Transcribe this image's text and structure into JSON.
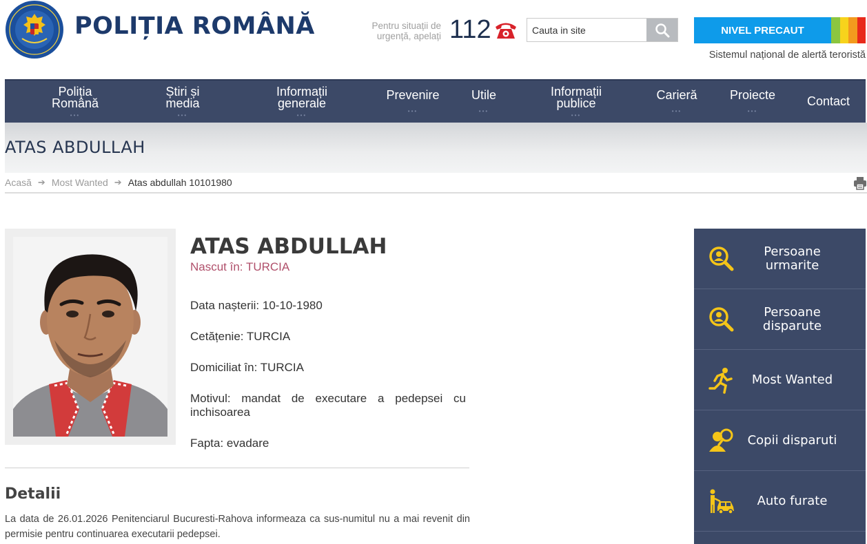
{
  "header": {
    "site_title": "POLIȚIA ROMÂNĂ",
    "emergency_text_1": "Pentru situații de",
    "emergency_text_2": "urgență, apelați",
    "emergency_number": "112",
    "search_placeholder": "Cauta in site",
    "alert_level": "NIVEL PRECAUT",
    "alert_subtitle": "Sistemul național de alertă teroristă",
    "alert_colors": [
      "#8cc63f",
      "#f7d31c",
      "#f39a1e",
      "#e8291b"
    ]
  },
  "nav": {
    "items": [
      {
        "label_1": "Poliția",
        "label_2": "Română"
      },
      {
        "label_1": "Știri și",
        "label_2": "media"
      },
      {
        "label_1": "Informații",
        "label_2": "generale"
      },
      {
        "label_1": "Prevenire",
        "label_2": ""
      },
      {
        "label_1": "Utile",
        "label_2": ""
      },
      {
        "label_1": "Informații",
        "label_2": "publice"
      },
      {
        "label_1": "Carieră",
        "label_2": ""
      },
      {
        "label_1": "Proiecte",
        "label_2": ""
      },
      {
        "label_1": "Contact",
        "label_2": ""
      }
    ],
    "dots": "•••"
  },
  "page": {
    "title": "ATAS ABDULLAH"
  },
  "breadcrumb": {
    "home": "Acasă",
    "section": "Most Wanted",
    "current": "Atas abdullah 10101980",
    "separator": "➔"
  },
  "profile": {
    "name": "ATAS ABDULLAH",
    "born": "Nascut în: TURCIA",
    "birth_date": "Data nașterii: 10-10-1980",
    "citizenship": "Cetățenie: TURCIA",
    "residence": "Domiciliat în: TURCIA",
    "reason": "Motivul: mandat de executare a pedepsei cu inchisoarea",
    "offense": "Fapta: evadare"
  },
  "details": {
    "heading": "Detalii",
    "text": "La data de 26.01.2026 Penitenciarul Bucuresti-Rahova informeaza ca sus-numitul nu a mai revenit din permisie pentru continuarea executarii pedepsei."
  },
  "sidebar": {
    "items": [
      {
        "label": "Persoane urmarite",
        "icon": "search-person-icon"
      },
      {
        "label": "Persoane disparute",
        "icon": "search-person-icon"
      },
      {
        "label": "Most Wanted",
        "icon": "running-person-icon"
      },
      {
        "label": "Copii disparuti",
        "icon": "child-search-icon"
      },
      {
        "label": "Auto furate",
        "icon": "stolen-car-icon"
      }
    ],
    "accent_color": "#f5c518"
  }
}
